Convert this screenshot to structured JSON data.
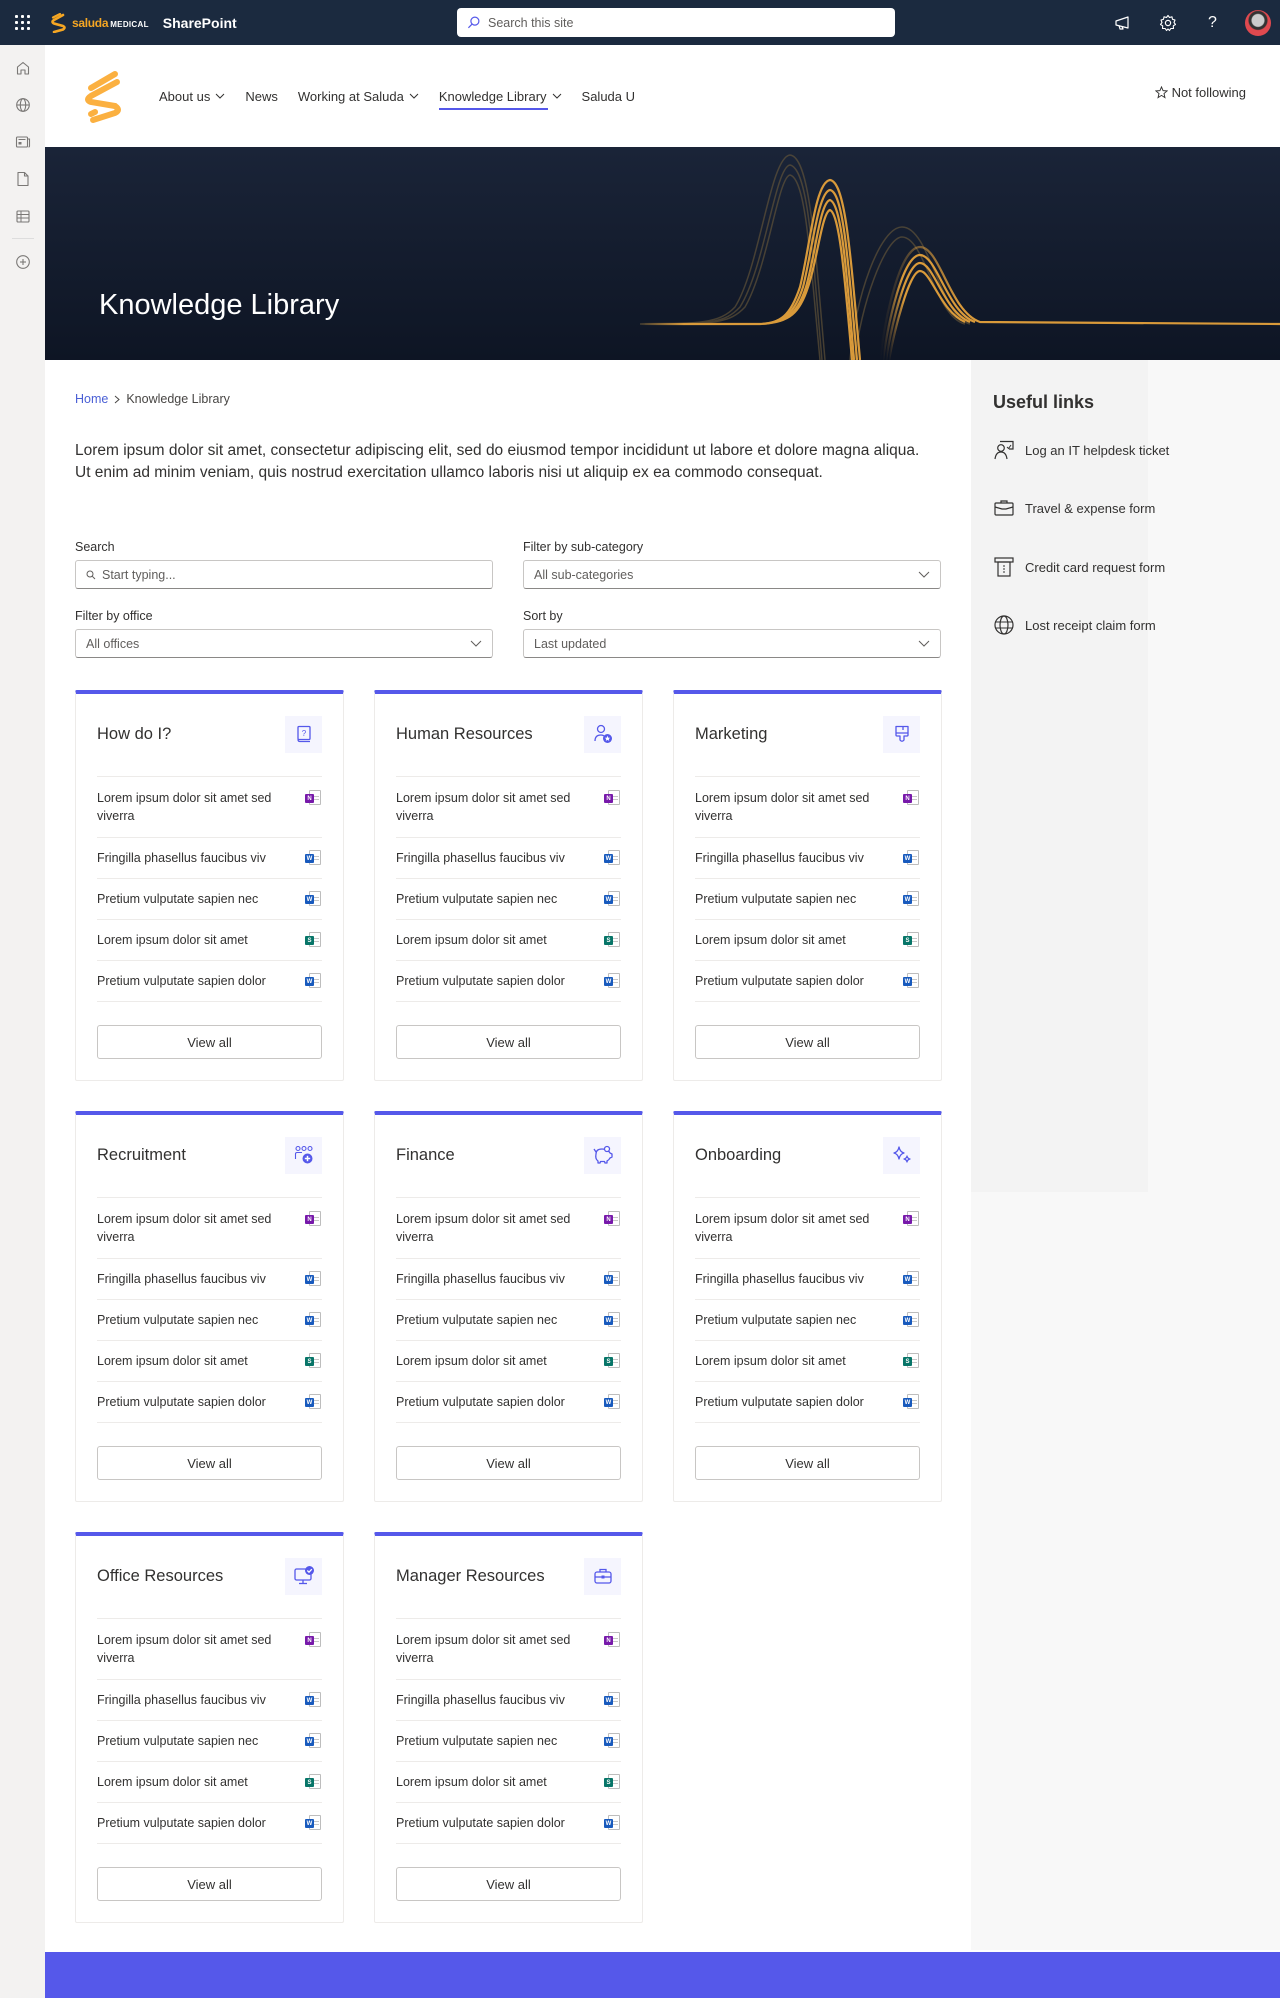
{
  "suitebar": {
    "brand_name": "saluda",
    "brand_suffix": "MEDICAL",
    "app_name": "SharePoint",
    "search_placeholder": "Search this site",
    "icons": [
      "megaphone-icon",
      "settings-icon",
      "help-icon",
      "avatar"
    ]
  },
  "leftrail": {
    "items": [
      "home-icon",
      "globe-icon",
      "news-icon",
      "file-icon",
      "list-icon",
      "add-icon"
    ]
  },
  "header": {
    "nav": [
      {
        "label": "About us",
        "has_dropdown": true,
        "active": false
      },
      {
        "label": "News",
        "has_dropdown": false,
        "active": false
      },
      {
        "label": "Working at Saluda",
        "has_dropdown": true,
        "active": false
      },
      {
        "label": "Knowledge Library",
        "has_dropdown": true,
        "active": true
      },
      {
        "label": "Saluda U",
        "has_dropdown": false,
        "active": false
      }
    ],
    "follow_label": "Not following"
  },
  "hero": {
    "title": "Knowledge Library"
  },
  "breadcrumb": {
    "home": "Home",
    "current": "Knowledge Library"
  },
  "intro": "Lorem ipsum dolor sit amet, consectetur adipiscing elit, sed do eiusmod tempor incididunt ut labore et dolore magna aliqua. Ut enim ad minim veniam, quis nostrud exercitation ullamco laboris nisi ut aliquip ex ea commodo consequat.",
  "filters": {
    "search": {
      "label": "Search",
      "placeholder": "Start typing..."
    },
    "subcategory": {
      "label": "Filter by sub-category",
      "value": "All sub-categories"
    },
    "office": {
      "label": "Filter by office",
      "value": "All offices"
    },
    "sort": {
      "label": "Sort by",
      "value": "Last updated"
    }
  },
  "cards": [
    {
      "title": "How do I?",
      "icon": "question-book-icon"
    },
    {
      "title": "Human Resources",
      "icon": "person-star-icon"
    },
    {
      "title": "Marketing",
      "icon": "paintbrush-icon"
    },
    {
      "title": "Recruitment",
      "icon": "people-add-icon"
    },
    {
      "title": "Finance",
      "icon": "piggy-bank-icon"
    },
    {
      "title": "Onboarding",
      "icon": "sparkle-icon"
    },
    {
      "title": "Office Resources",
      "icon": "desktop-check-icon"
    },
    {
      "title": "Manager Resources",
      "icon": "briefcase-icon"
    }
  ],
  "card_items": [
    {
      "text": "Lorem ipsum dolor sit amet sed viverra",
      "type": "onenote",
      "badge": "N"
    },
    {
      "text": "Fringilla phasellus faucibus viv",
      "type": "word",
      "badge": "W"
    },
    {
      "text": "Pretium vulputate sapien nec",
      "type": "word",
      "badge": "W"
    },
    {
      "text": "Lorem ipsum dolor sit amet",
      "type": "sway",
      "badge": "S"
    },
    {
      "text": "Pretium vulputate sapien dolor",
      "type": "word",
      "badge": "W"
    }
  ],
  "view_all_label": "View all",
  "useful_links": {
    "title": "Useful links",
    "items": [
      {
        "label": "Log an IT helpdesk ticket",
        "icon": "person-feedback-icon"
      },
      {
        "label": "Travel & expense form",
        "icon": "briefcase-icon"
      },
      {
        "label": "Credit card request form",
        "icon": "card-withdraw-icon"
      },
      {
        "label": "Lost receipt claim form",
        "icon": "globe-icon"
      }
    ]
  },
  "colors": {
    "accent": "#5558ea",
    "suitebar": "#1b2a3f",
    "brand_orange": "#f5a623"
  }
}
